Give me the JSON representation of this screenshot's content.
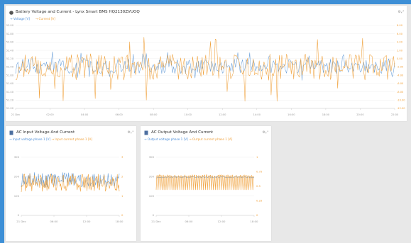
{
  "colors": {
    "background": "#3d8fd6",
    "voltage": "#6a9fd8",
    "current": "#f0a13b"
  },
  "cards": {
    "top": {
      "title": "Battery Voltage and Current - Lynx Smart BMS HQ2130ZVUOQ",
      "legend_voltage": "Voltage [V]",
      "legend_current": "Current [A]",
      "icon": "record-icon"
    },
    "ac_input": {
      "title": "AC Input Voltage And Current",
      "legend_voltage": "Input voltage phase 1 [V]",
      "legend_current": "Input current phase 1 [A]",
      "icon": "document-icon"
    },
    "ac_output": {
      "title": "AC Output Voltage And Current",
      "legend_voltage": "Output voltage phase 1 [V]",
      "legend_current": "Output current phase 1 [A]",
      "icon": "document-icon"
    }
  },
  "chart_data": [
    {
      "type": "line",
      "title": "Battery Voltage and Current - Lynx Smart BMS HQ2130ZVUOQ",
      "x_ticks": [
        "21 Dec",
        "02:00",
        "04:00",
        "06:00",
        "08:00",
        "10:00",
        "12:00",
        "14:00",
        "16:00",
        "18:00",
        "20:00",
        "22:00"
      ],
      "y_left_ticks": [
        "53.00",
        "52.80",
        "52.60",
        "52.40",
        "52.20",
        "52.00",
        "51.80",
        "51.60",
        "51.40",
        "51.20",
        "51.00"
      ],
      "y_right_ticks": [
        "8.00",
        "6.00",
        "4.00",
        "2.00",
        "0.00",
        "-2.00",
        "-4.00",
        "-6.00",
        "-8.00",
        "-10.00",
        "-12.00"
      ],
      "ylim_left": [
        51.0,
        53.0
      ],
      "ylim_right": [
        -12.0,
        8.0
      ],
      "series": [
        {
          "name": "Voltage [V]",
          "axis": "left",
          "center": 52.02,
          "spread": 0.18,
          "spike": 0.35
        },
        {
          "name": "Current [A]",
          "axis": "right",
          "center": -2.0,
          "spread": 3.2,
          "spike": 8.5
        }
      ]
    },
    {
      "type": "line",
      "title": "AC Input Voltage And Current",
      "x_ticks": [
        "21 Dec",
        "06:00",
        "12:00",
        "18:00"
      ],
      "y_left_ticks": [
        "300",
        "200",
        "100",
        "0"
      ],
      "y_right_ticks": [
        "3",
        "2",
        "1",
        "0"
      ],
      "ylim_left": [
        0,
        350
      ],
      "ylim_right": [
        0,
        3.5
      ],
      "series": [
        {
          "name": "Input voltage phase 1 [V]",
          "axis": "left",
          "center": 215,
          "spread": 45
        },
        {
          "name": "Input current phase 1 [A]",
          "axis": "right",
          "center": 1.95,
          "spread": 0.55
        }
      ]
    },
    {
      "type": "line",
      "title": "AC Output Voltage And Current",
      "x_ticks": [
        "21 Dec",
        "06:00",
        "12:00",
        "18:00"
      ],
      "y_left_ticks": [
        "300",
        "200",
        "100",
        "0"
      ],
      "y_right_ticks": [
        "1",
        "0.75",
        "0.5",
        "0.25",
        "0"
      ],
      "ylim_left": [
        0,
        350
      ],
      "ylim_right": [
        0,
        1.25
      ],
      "series": [
        {
          "name": "Output voltage phase 1 [V]",
          "axis": "left",
          "center": 230,
          "spread": 4
        },
        {
          "name": "Output current phase 1 [A]",
          "axis": "right",
          "center": 0.85,
          "spread": 0.12
        }
      ]
    }
  ]
}
